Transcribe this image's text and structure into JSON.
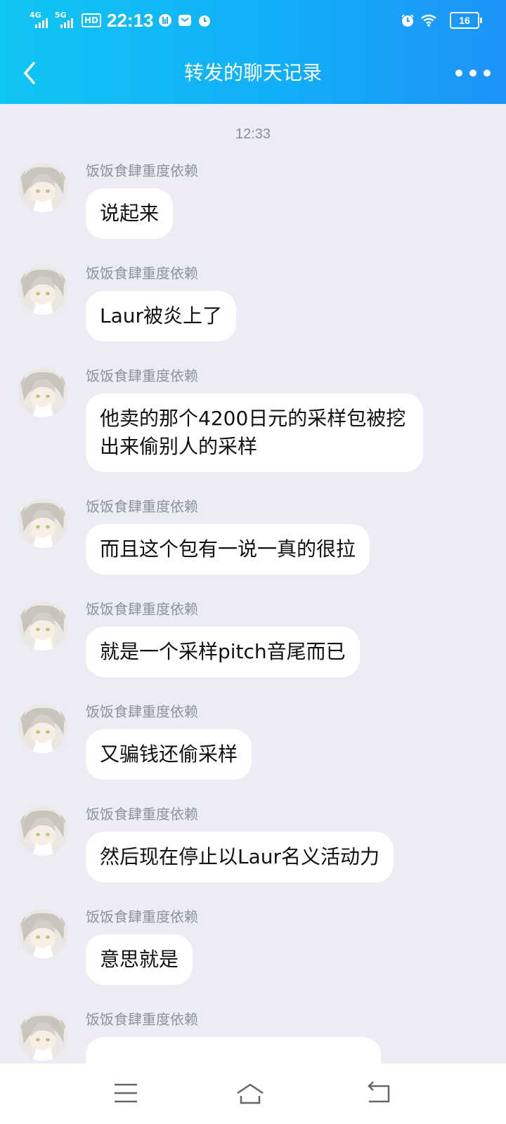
{
  "status_bar": {
    "signal_1": "4G",
    "signal_2": "5G",
    "hd": "HD",
    "time": "22:13",
    "battery": "16",
    "icons": [
      "data-saver-icon",
      "mail-icon",
      "alarm-icon",
      "alarm-icon",
      "wifi-icon",
      "battery-icon"
    ]
  },
  "header": {
    "title": "转发的聊天记录",
    "back_icon": "chevron-left-icon",
    "more_icon": "more-icon"
  },
  "chat": {
    "timestamp": "12:33",
    "messages": [
      {
        "sender": "饭饭食肆重度依赖",
        "text": "说起来"
      },
      {
        "sender": "饭饭食肆重度依赖",
        "text": "Laur被炎上了"
      },
      {
        "sender": "饭饭食肆重度依赖",
        "text": "他卖的那个4200日元的采样包被挖出来偷别人的采样"
      },
      {
        "sender": "饭饭食肆重度依赖",
        "text": "而且这个包有一说一真的很拉"
      },
      {
        "sender": "饭饭食肆重度依赖",
        "text": "就是一个采样pitch音尾而已"
      },
      {
        "sender": "饭饭食肆重度依赖",
        "text": "又骗钱还偷采样"
      },
      {
        "sender": "饭饭食肆重度依赖",
        "text": "然后现在停止以Laur名义活动力"
      },
      {
        "sender": "饭饭食肆重度依赖",
        "text": "意思就是"
      },
      {
        "sender": "饭饭食肆重度依赖",
        "text": ""
      }
    ]
  },
  "bottom_nav": {
    "icons": [
      "menu-icon",
      "home-icon",
      "back-icon"
    ]
  },
  "colors": {
    "header_start": "#10c6f4",
    "header_end": "#1d93f8",
    "chat_bg": "#ecedf4",
    "bubble_bg": "#ffffff"
  }
}
